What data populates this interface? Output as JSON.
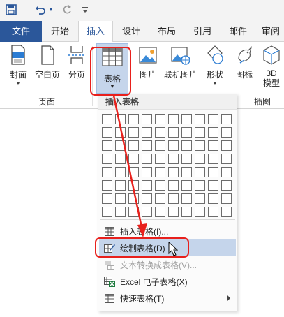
{
  "tabs": [
    {
      "label": "文件"
    },
    {
      "label": "开始"
    },
    {
      "label": "插入"
    },
    {
      "label": "设计"
    },
    {
      "label": "布局"
    },
    {
      "label": "引用"
    },
    {
      "label": "邮件"
    },
    {
      "label": "审阅"
    }
  ],
  "ribbon": {
    "cover": "封面",
    "blank_page": "空白页",
    "page_break": "分页",
    "table": "表格",
    "picture": "图片",
    "online_picture": "联机图片",
    "shapes": "形状",
    "icons": "图标",
    "model3d_line1": "3D",
    "model3d_line2": "模型",
    "group_pages": "页面",
    "group_illustrations": "插图"
  },
  "dropdown": {
    "header": "插入表格",
    "items": [
      {
        "label": "插入表格(I)...",
        "icon": "insert-table-icon",
        "disabled": false
      },
      {
        "label": "绘制表格(D)",
        "icon": "draw-table-icon",
        "disabled": false
      },
      {
        "label": "文本转换成表格(V)...",
        "icon": "convert-text-icon",
        "disabled": true
      },
      {
        "label": "Excel 电子表格(X)",
        "icon": "excel-icon",
        "disabled": false
      },
      {
        "label": "快速表格(T)",
        "icon": "quick-table-icon",
        "disabled": false
      }
    ]
  },
  "colors": {
    "accent": "#2b579a",
    "highlight": "#c5d5eb",
    "annotation": "#e8201c"
  }
}
